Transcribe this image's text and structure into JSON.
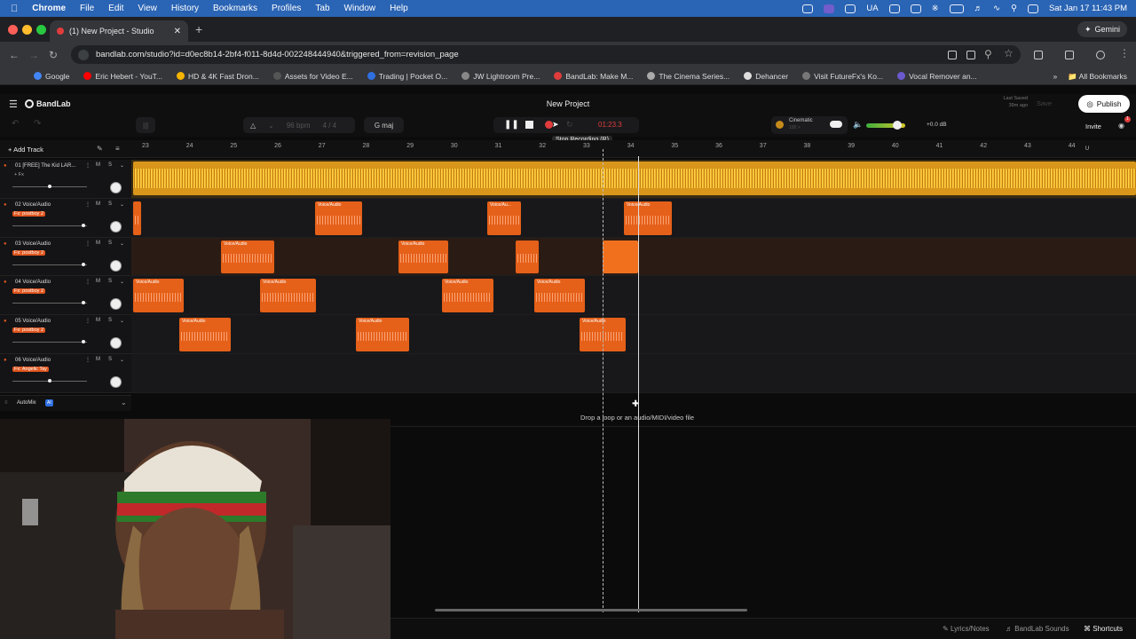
{
  "menubar": {
    "app": "Chrome",
    "items": [
      "File",
      "Edit",
      "View",
      "History",
      "Bookmarks",
      "Profiles",
      "Tab",
      "Window",
      "Help"
    ],
    "input_source": "UA",
    "datetime": "Sat Jan 17  11:43 PM"
  },
  "browser": {
    "tab_title": "(1) New Project - Studio",
    "url": "bandlab.com/studio?id=d0ec8b14-2bf4-f011-8d4d-002248444940&triggered_from=revision_page",
    "gemini_label": "Gemini",
    "bookmarks": [
      {
        "label": "Google",
        "color": "#4285f4"
      },
      {
        "label": "Eric Hebert - YouT...",
        "color": "#ff0000"
      },
      {
        "label": "HD & 4K Fast Dron...",
        "color": "#f4b400"
      },
      {
        "label": "Assets for Video E...",
        "color": "#555555"
      },
      {
        "label": "Trading | Pocket O...",
        "color": "#2f6fe0"
      },
      {
        "label": "JW Lightroom Pre...",
        "color": "#888888"
      },
      {
        "label": "BandLab: Make M...",
        "color": "#e03c3c"
      },
      {
        "label": "The Cinema Series...",
        "color": "#aaaaaa"
      },
      {
        "label": "Dehancer",
        "color": "#dddddd"
      },
      {
        "label": "Visit FutureFx's Ko...",
        "color": "#777777"
      },
      {
        "label": "Vocal Remover an...",
        "color": "#6a5acd"
      }
    ],
    "all_bookmarks": "All Bookmarks"
  },
  "studio": {
    "brand": "BandLab",
    "project_title": "New Project",
    "last_saved": "Last Saved",
    "last_saved_time": "39m ago",
    "save_label": "Save",
    "publish_label": "Publish",
    "invite_label": "Invite",
    "notification_count": "1",
    "bpm": "96 bpm",
    "time_sig": "4 / 4",
    "key": "G maj",
    "time_display": "01:23.3",
    "tooltip": "Stop Recording (R)",
    "preset_name": "Cinematic",
    "preset_sub": "100 >",
    "master_db": "+0.0 dB",
    "add_track": "Add Track",
    "automix": "AutoMix",
    "automix_badge": "AI",
    "drop_hint": "Drop a loop or an audio/MIDI/video file",
    "ruler": [
      "23",
      "24",
      "25",
      "26",
      "27",
      "28",
      "29",
      "30",
      "31",
      "32",
      "33",
      "34",
      "35",
      "36",
      "37",
      "38",
      "39",
      "40",
      "41",
      "42",
      "43",
      "44"
    ],
    "tracks": [
      {
        "number": "01",
        "name": "[FREE] The Kid LAR...",
        "fx": "+ Fx",
        "volume": 0.5
      },
      {
        "number": "02",
        "name": "Voice/Audio",
        "fx": "Fx: postboy 2",
        "volume": 0.95
      },
      {
        "number": "03",
        "name": "Voice/Audio",
        "fx": "Fx: postboy 2",
        "volume": 0.95
      },
      {
        "number": "04",
        "name": "Voice/Audio",
        "fx": "Fx: postboy 2",
        "volume": 0.95
      },
      {
        "number": "05",
        "name": "Voice/Audio",
        "fx": "Fx: postboy 2",
        "volume": 0.95
      },
      {
        "number": "06",
        "name": "Voice/Audio",
        "fx": "Fx: Angelic Tay",
        "volume": 0.5
      }
    ],
    "clip_label": "Voice/Audio",
    "clip_label_short": "Voice/Au...",
    "mute": "M",
    "solo": "S",
    "footer": {
      "lyrics": "Lyrics/Notes",
      "sounds": "BandLab Sounds",
      "shortcuts": "Shortcuts"
    }
  },
  "colors": {
    "accent_orange": "#e56019",
    "beat_track": "#e8a317",
    "record_red": "#e03c3c"
  }
}
